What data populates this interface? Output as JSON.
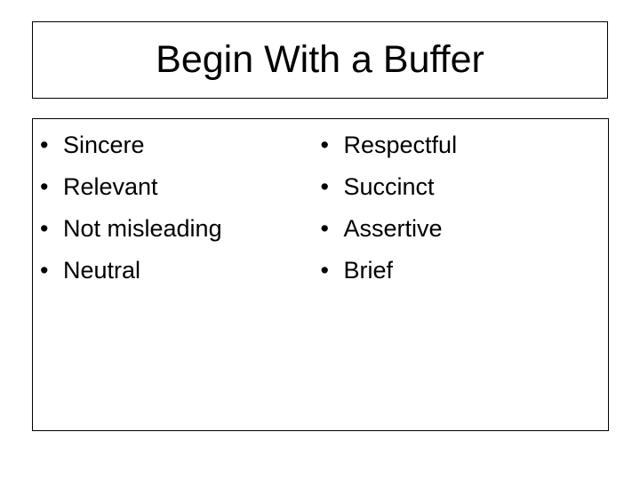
{
  "slide": {
    "title": "Begin With a Buffer",
    "bullet_glyph": "•",
    "colors": {
      "background": "#ffffff",
      "text": "#000000",
      "border": "#000000"
    },
    "content": {
      "columns": [
        {
          "name": "left-column",
          "items": [
            {
              "label": "Sincere"
            },
            {
              "label": "Relevant"
            },
            {
              "label": "Not misleading"
            },
            {
              "label": "Neutral"
            }
          ]
        },
        {
          "name": "right-column",
          "items": [
            {
              "label": "Respectful"
            },
            {
              "label": "Succinct"
            },
            {
              "label": "Assertive"
            },
            {
              "label": "Brief"
            }
          ]
        }
      ]
    }
  }
}
